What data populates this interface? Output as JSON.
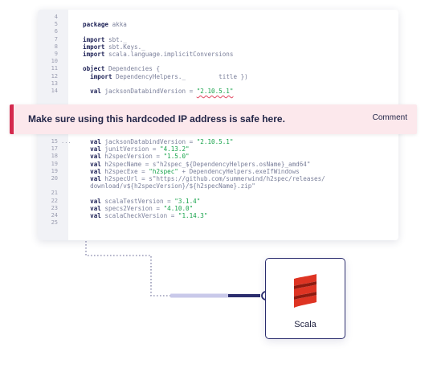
{
  "code": {
    "lines_top": [
      {
        "n": "4",
        "fold": "",
        "parts": []
      },
      {
        "n": "5",
        "fold": "",
        "parts": [
          {
            "t": "package",
            "c": "kw"
          },
          {
            "t": " akka",
            "c": ""
          }
        ]
      },
      {
        "n": "6",
        "fold": "",
        "parts": []
      },
      {
        "n": "7",
        "fold": "",
        "parts": [
          {
            "t": "import",
            "c": "kw"
          },
          {
            "t": " sbt._",
            "c": ""
          }
        ]
      },
      {
        "n": "8",
        "fold": "",
        "parts": [
          {
            "t": "import",
            "c": "kw"
          },
          {
            "t": " sbt.Keys._",
            "c": ""
          }
        ]
      },
      {
        "n": "9",
        "fold": "",
        "parts": [
          {
            "t": "import",
            "c": "kw"
          },
          {
            "t": " scala.language.implicitConversions",
            "c": ""
          }
        ]
      },
      {
        "n": "10",
        "fold": "",
        "parts": []
      },
      {
        "n": "11",
        "fold": "",
        "parts": [
          {
            "t": "object",
            "c": "kw"
          },
          {
            "t": " Dependencies {",
            "c": ""
          }
        ]
      },
      {
        "n": "12",
        "fold": "",
        "parts": [
          {
            "t": "  import",
            "c": "kw"
          },
          {
            "t": " DependencyHelpers._",
            "c": ""
          },
          {
            "t": "         ",
            "c": ""
          },
          {
            "t": "title })",
            "c": ""
          }
        ]
      },
      {
        "n": "13",
        "fold": "",
        "parts": []
      },
      {
        "n": "14",
        "fold": "",
        "parts": [
          {
            "t": "  val",
            "c": "kw"
          },
          {
            "t": " jacksonDatabindVersion = ",
            "c": ""
          },
          {
            "t": "\"2.10.5.1\"",
            "c": "str uline"
          }
        ]
      }
    ],
    "lines_bottom": [
      {
        "n": "15",
        "fold": "...",
        "parts": [
          {
            "t": "  val",
            "c": "kw"
          },
          {
            "t": " jacksonDatabindVersion = ",
            "c": ""
          },
          {
            "t": "\"2.10.5.1\"",
            "c": "str"
          }
        ]
      },
      {
        "n": "17",
        "fold": "",
        "parts": [
          {
            "t": "  val",
            "c": "kw"
          },
          {
            "t": " junitVersion = ",
            "c": ""
          },
          {
            "t": "\"4.13.2\"",
            "c": "str"
          }
        ]
      },
      {
        "n": "18",
        "fold": "",
        "parts": [
          {
            "t": "  val",
            "c": "kw"
          },
          {
            "t": " h2specVersion = ",
            "c": ""
          },
          {
            "t": "\"1.5.0\"",
            "c": "str"
          }
        ]
      },
      {
        "n": "19",
        "fold": "",
        "parts": [
          {
            "t": "  val",
            "c": "kw"
          },
          {
            "t": " h2specName = s\"h2spec_${DependencyHelpers.osName}_amd64\"",
            "c": ""
          }
        ]
      },
      {
        "n": "19",
        "fold": "",
        "parts": [
          {
            "t": "  val",
            "c": "kw"
          },
          {
            "t": " h2specExe = ",
            "c": ""
          },
          {
            "t": "\"h2spec\"",
            "c": "str"
          },
          {
            "t": " + DependencyHelpers.exeIfWindows",
            "c": ""
          }
        ]
      },
      {
        "n": "20",
        "fold": "",
        "parts": [
          {
            "t": "  val",
            "c": "kw"
          },
          {
            "t": " h2specUrl = s\"https://github.com/summerwind/h2spec/releases/",
            "c": ""
          }
        ]
      },
      {
        "n": "",
        "fold": "",
        "parts": [
          {
            "t": "  download/v${h2specVersion}/${h2specName}.zip\"",
            "c": ""
          }
        ]
      },
      {
        "n": "21",
        "fold": "",
        "parts": []
      },
      {
        "n": "22",
        "fold": "",
        "parts": [
          {
            "t": "  val",
            "c": "kw"
          },
          {
            "t": " scalaTestVersion = ",
            "c": ""
          },
          {
            "t": "\"3.1.4\"",
            "c": "str"
          }
        ]
      },
      {
        "n": "23",
        "fold": "",
        "parts": [
          {
            "t": "  val",
            "c": "kw"
          },
          {
            "t": " specs2Version = ",
            "c": ""
          },
          {
            "t": "\"4.10.0\"",
            "c": "str"
          }
        ]
      },
      {
        "n": "24",
        "fold": "",
        "parts": [
          {
            "t": "  val",
            "c": "kw"
          },
          {
            "t": " scalaCheckVersion = ",
            "c": ""
          },
          {
            "t": "\"1.14.3\"",
            "c": "str"
          }
        ]
      },
      {
        "n": "25",
        "fold": "",
        "parts": []
      }
    ]
  },
  "banner": {
    "message": "Make sure using this hardcoded IP address is safe here.",
    "action": "Comment"
  },
  "card": {
    "label": "Scala",
    "icon": "scala-logo-icon"
  },
  "colors": {
    "accent": "#2b2d6e",
    "danger": "#d42a4e",
    "banner_bg": "#fce8ec",
    "string": "#16a34a",
    "scala_red": "#de3423"
  }
}
